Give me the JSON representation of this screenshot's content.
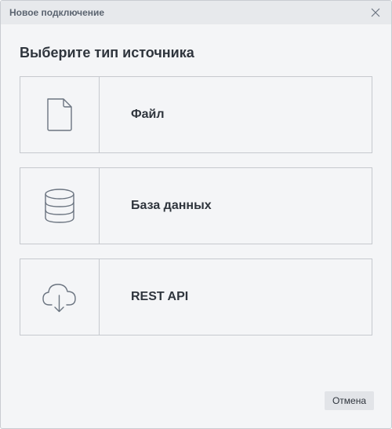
{
  "window": {
    "title": "Новое подключение",
    "close_icon": "close-icon"
  },
  "heading": "Выберите тип источника",
  "options": [
    {
      "label": "Файл",
      "icon": "file-icon"
    },
    {
      "label": "База данных",
      "icon": "database-icon"
    },
    {
      "label": "REST API",
      "icon": "cloud-download-icon"
    }
  ],
  "footer": {
    "cancel_label": "Отмена"
  },
  "colors": {
    "titlebar_bg": "#e7e9ec",
    "dialog_bg": "#f4f5f7",
    "border": "#c6c9ce",
    "icon": "#6b7480",
    "text": "#2f353d",
    "button_bg": "#e2e4e8"
  }
}
